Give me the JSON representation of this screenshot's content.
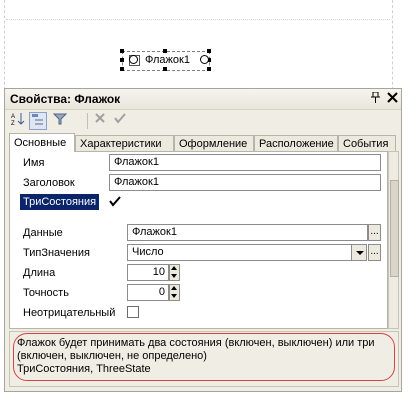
{
  "designer": {
    "flag_label": "Флажок1"
  },
  "window": {
    "title": "Свойства: Флажок",
    "pin_icon": "pin-icon",
    "close_icon": "close-icon"
  },
  "toolbar": {
    "icons": [
      "sort-alpha-icon",
      "categories-icon",
      "filter-icon",
      "cancel-icon",
      "apply-icon"
    ]
  },
  "tabs": [
    "Основные",
    "Характеристики",
    "Оформление",
    "Расположение",
    "События"
  ],
  "selected_tab": "Основные",
  "properties": {
    "name": {
      "label": "Имя",
      "value": "Флажок1"
    },
    "caption": {
      "label": "Заголовок",
      "value": "Флажок1"
    },
    "tristate": {
      "label": "ТриСостояния",
      "checked": true
    },
    "data": {
      "label": "Данные",
      "value": "Флажок1"
    },
    "value_type": {
      "label": "ТипЗначения",
      "value": "Число"
    },
    "length": {
      "label": "Длина",
      "value": "10"
    },
    "precision": {
      "label": "Точность",
      "value": "0"
    },
    "nonnegative": {
      "label": "Неотрицательный",
      "checked": false
    }
  },
  "description": {
    "line1": "Флажок будет принимать два состояния  (включен, выключен) или три",
    "line2": "(включен, выключен, не определено)",
    "line3": "ТриСостояния, ThreeState"
  },
  "colors": {
    "selection": "#0a246a",
    "highlight_oval": "#d24444",
    "window_bg": "#f0ede4"
  }
}
